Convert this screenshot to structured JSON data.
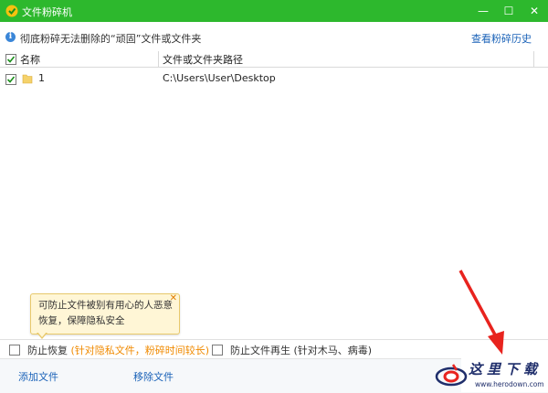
{
  "window": {
    "title": "文件粉碎机",
    "app_icon": "360-shredder-icon",
    "controls": [
      "minimize",
      "maximize",
      "close"
    ],
    "control_glyphs": {
      "minimize": "—",
      "maximize": "☐",
      "close": "✕"
    }
  },
  "info": {
    "icon": "info-icon",
    "text": "彻底粉碎无法删除的“顽固”文件或文件夹",
    "history_link": "查看粉碎历史"
  },
  "table": {
    "columns": [
      "名称",
      "文件或文件夹路径"
    ],
    "rows": [
      {
        "checked": true,
        "icon": "folder-icon",
        "name": "1",
        "path": "C:\\Users\\User\\Desktop"
      }
    ]
  },
  "tooltip": {
    "text": "可防止文件被别有用心的人恶意恢复，保障隐私安全",
    "close_glyph": "✕"
  },
  "options": [
    {
      "checked": false,
      "label": "防止恢复",
      "note": "(针对隐私文件，粉碎时间较长)"
    },
    {
      "checked": false,
      "label": "防止文件再生",
      "note": "(针对木马、病毒)"
    }
  ],
  "actions": {
    "add_file": "添加文件",
    "remove_file": "移除文件"
  },
  "watermark": {
    "title": "这里下载",
    "url": "www.herodown.com"
  },
  "colors": {
    "titlebar": "#2db82d",
    "link": "#1a62b8",
    "accent_note": "#f08a00",
    "arrow": "#e8231e"
  }
}
